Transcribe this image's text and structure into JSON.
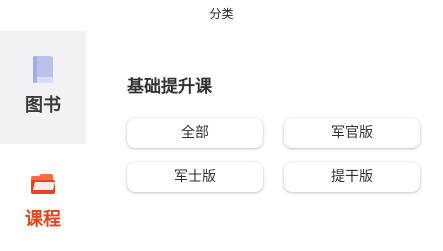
{
  "header": {
    "title": "分类"
  },
  "sidebar": {
    "items": [
      {
        "label": "图书",
        "icon": "book-icon",
        "selected": false
      },
      {
        "label": "课程",
        "icon": "folder-icon",
        "selected": true
      }
    ]
  },
  "main": {
    "section_title": "基础提升课",
    "filters": [
      {
        "label": "全部"
      },
      {
        "label": "军官版"
      },
      {
        "label": "军士版"
      },
      {
        "label": "提干版"
      }
    ]
  },
  "colors": {
    "accent": "#e8431f",
    "book_icon": "#b8c2ec",
    "selected_sidebar_bg": "#f2f2f4"
  }
}
